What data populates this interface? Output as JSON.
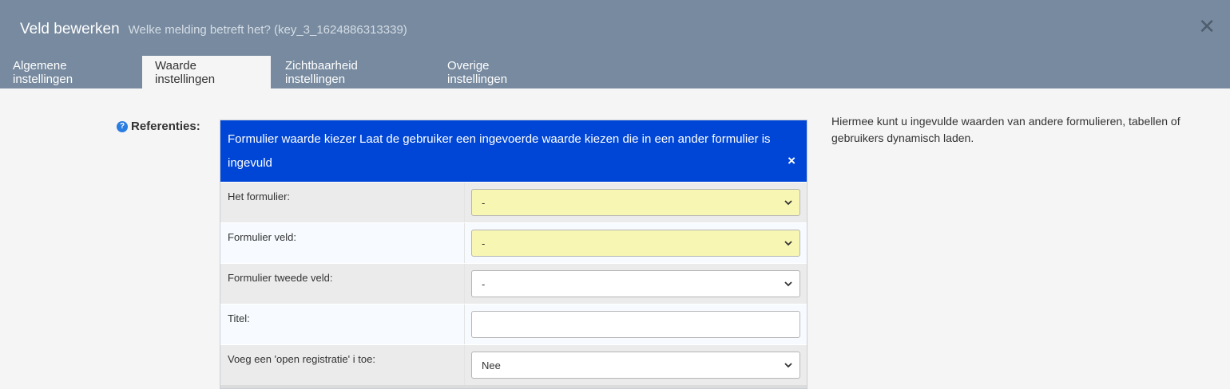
{
  "header": {
    "title": "Veld bewerken",
    "subtitle": "Welke melding betreft het? (key_3_1624886313339)",
    "close_icon": "close-icon"
  },
  "tabs": [
    {
      "label": "Algemene instellingen",
      "active": false
    },
    {
      "label": "Waarde instellingen",
      "active": true
    },
    {
      "label": "Zichtbaarheid instellingen",
      "active": false
    },
    {
      "label": "Overige instellingen",
      "active": false
    }
  ],
  "field": {
    "help_icon_glyph": "?",
    "label": "Referenties:"
  },
  "panel": {
    "title": "Formulier waarde kiezer Laat de gebruiker een ingevoerde waarde kiezen die in een ander formulier is ingevuld",
    "close_glyph": "×",
    "rows": [
      {
        "label": "Het formulier:",
        "type": "select",
        "value": "-",
        "highlight": true
      },
      {
        "label": "Formulier veld:",
        "type": "select",
        "value": "-",
        "highlight": true
      },
      {
        "label": "Formulier tweede veld:",
        "type": "select",
        "value": "-",
        "highlight": false
      },
      {
        "label": "Titel:",
        "type": "text",
        "value": "",
        "highlight": false
      },
      {
        "label": "Voeg een 'open registratie' i toe:",
        "type": "select",
        "value": "Nee",
        "highlight": false
      }
    ]
  },
  "help_text": "Hiermee kunt u ingevulde waarden van andere formulieren, tabellen of gebruikers dynamisch laden.",
  "colors": {
    "header_bg": "#778a9f",
    "panel_header": "#0046d6",
    "highlight_select": "#f8f6b3"
  }
}
